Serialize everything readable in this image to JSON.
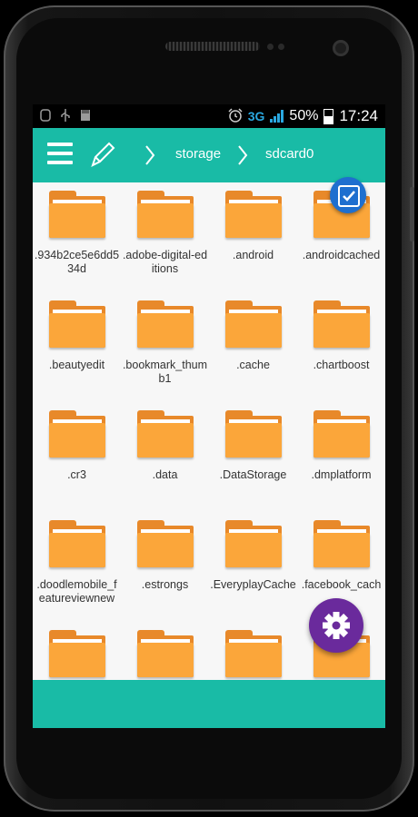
{
  "status_bar": {
    "network": "3G",
    "battery_percent": "50%",
    "time": "17:24",
    "left_icons": [
      "screenshot-icon",
      "usb-icon",
      "sd-card-icon"
    ],
    "right_icons": [
      "alarm-clock-icon",
      "signal-icon",
      "battery-icon"
    ]
  },
  "toolbar": {
    "crumbs": [
      "storage",
      "sdcard0"
    ],
    "color": "#19bba6"
  },
  "folders": [
    ".934b2ce5e6dd534d",
    ".adobe-digital-editions",
    ".android",
    ".androidcached",
    ".beautyedit",
    ".bookmark_thumb1",
    ".cache",
    ".chartboost",
    ".cr3",
    ".data",
    ".DataStorage",
    ".dmplatform",
    ".doodlemobile_featureviewnew",
    ".estrongs",
    ".EveryplayCache",
    ".facebook_cach",
    "",
    "",
    "",
    ""
  ],
  "colors": {
    "accent": "#19bba6",
    "folder": "#fba63a",
    "settings_fab": "#6a2a9c",
    "check_fab": "#1e6fcf"
  }
}
